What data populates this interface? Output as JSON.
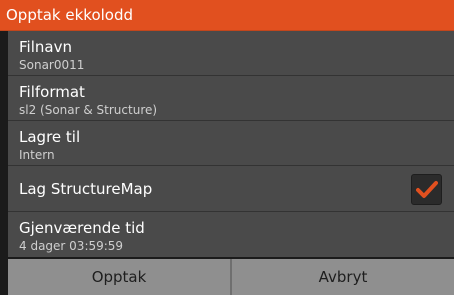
{
  "dialog": {
    "title": "Opptak ekkolodd",
    "rows": [
      {
        "label": "Filnavn",
        "value": "Sonar0011"
      },
      {
        "label": "Filformat",
        "value": "sl2 (Sonar & Structure)"
      },
      {
        "label": "Lagre til",
        "value": "Intern"
      },
      {
        "label": "Lag StructureMap",
        "checked": true
      },
      {
        "label": "Gjenværende tid",
        "value": "4 dager 03:59:59"
      }
    ],
    "buttons": {
      "record": "Opptak",
      "cancel": "Avbryt"
    }
  },
  "colors": {
    "accent": "#e1501f",
    "panel": "#4a4a4a",
    "button": "#8f8f8f"
  },
  "icons": {
    "checkbox": "check-icon"
  }
}
